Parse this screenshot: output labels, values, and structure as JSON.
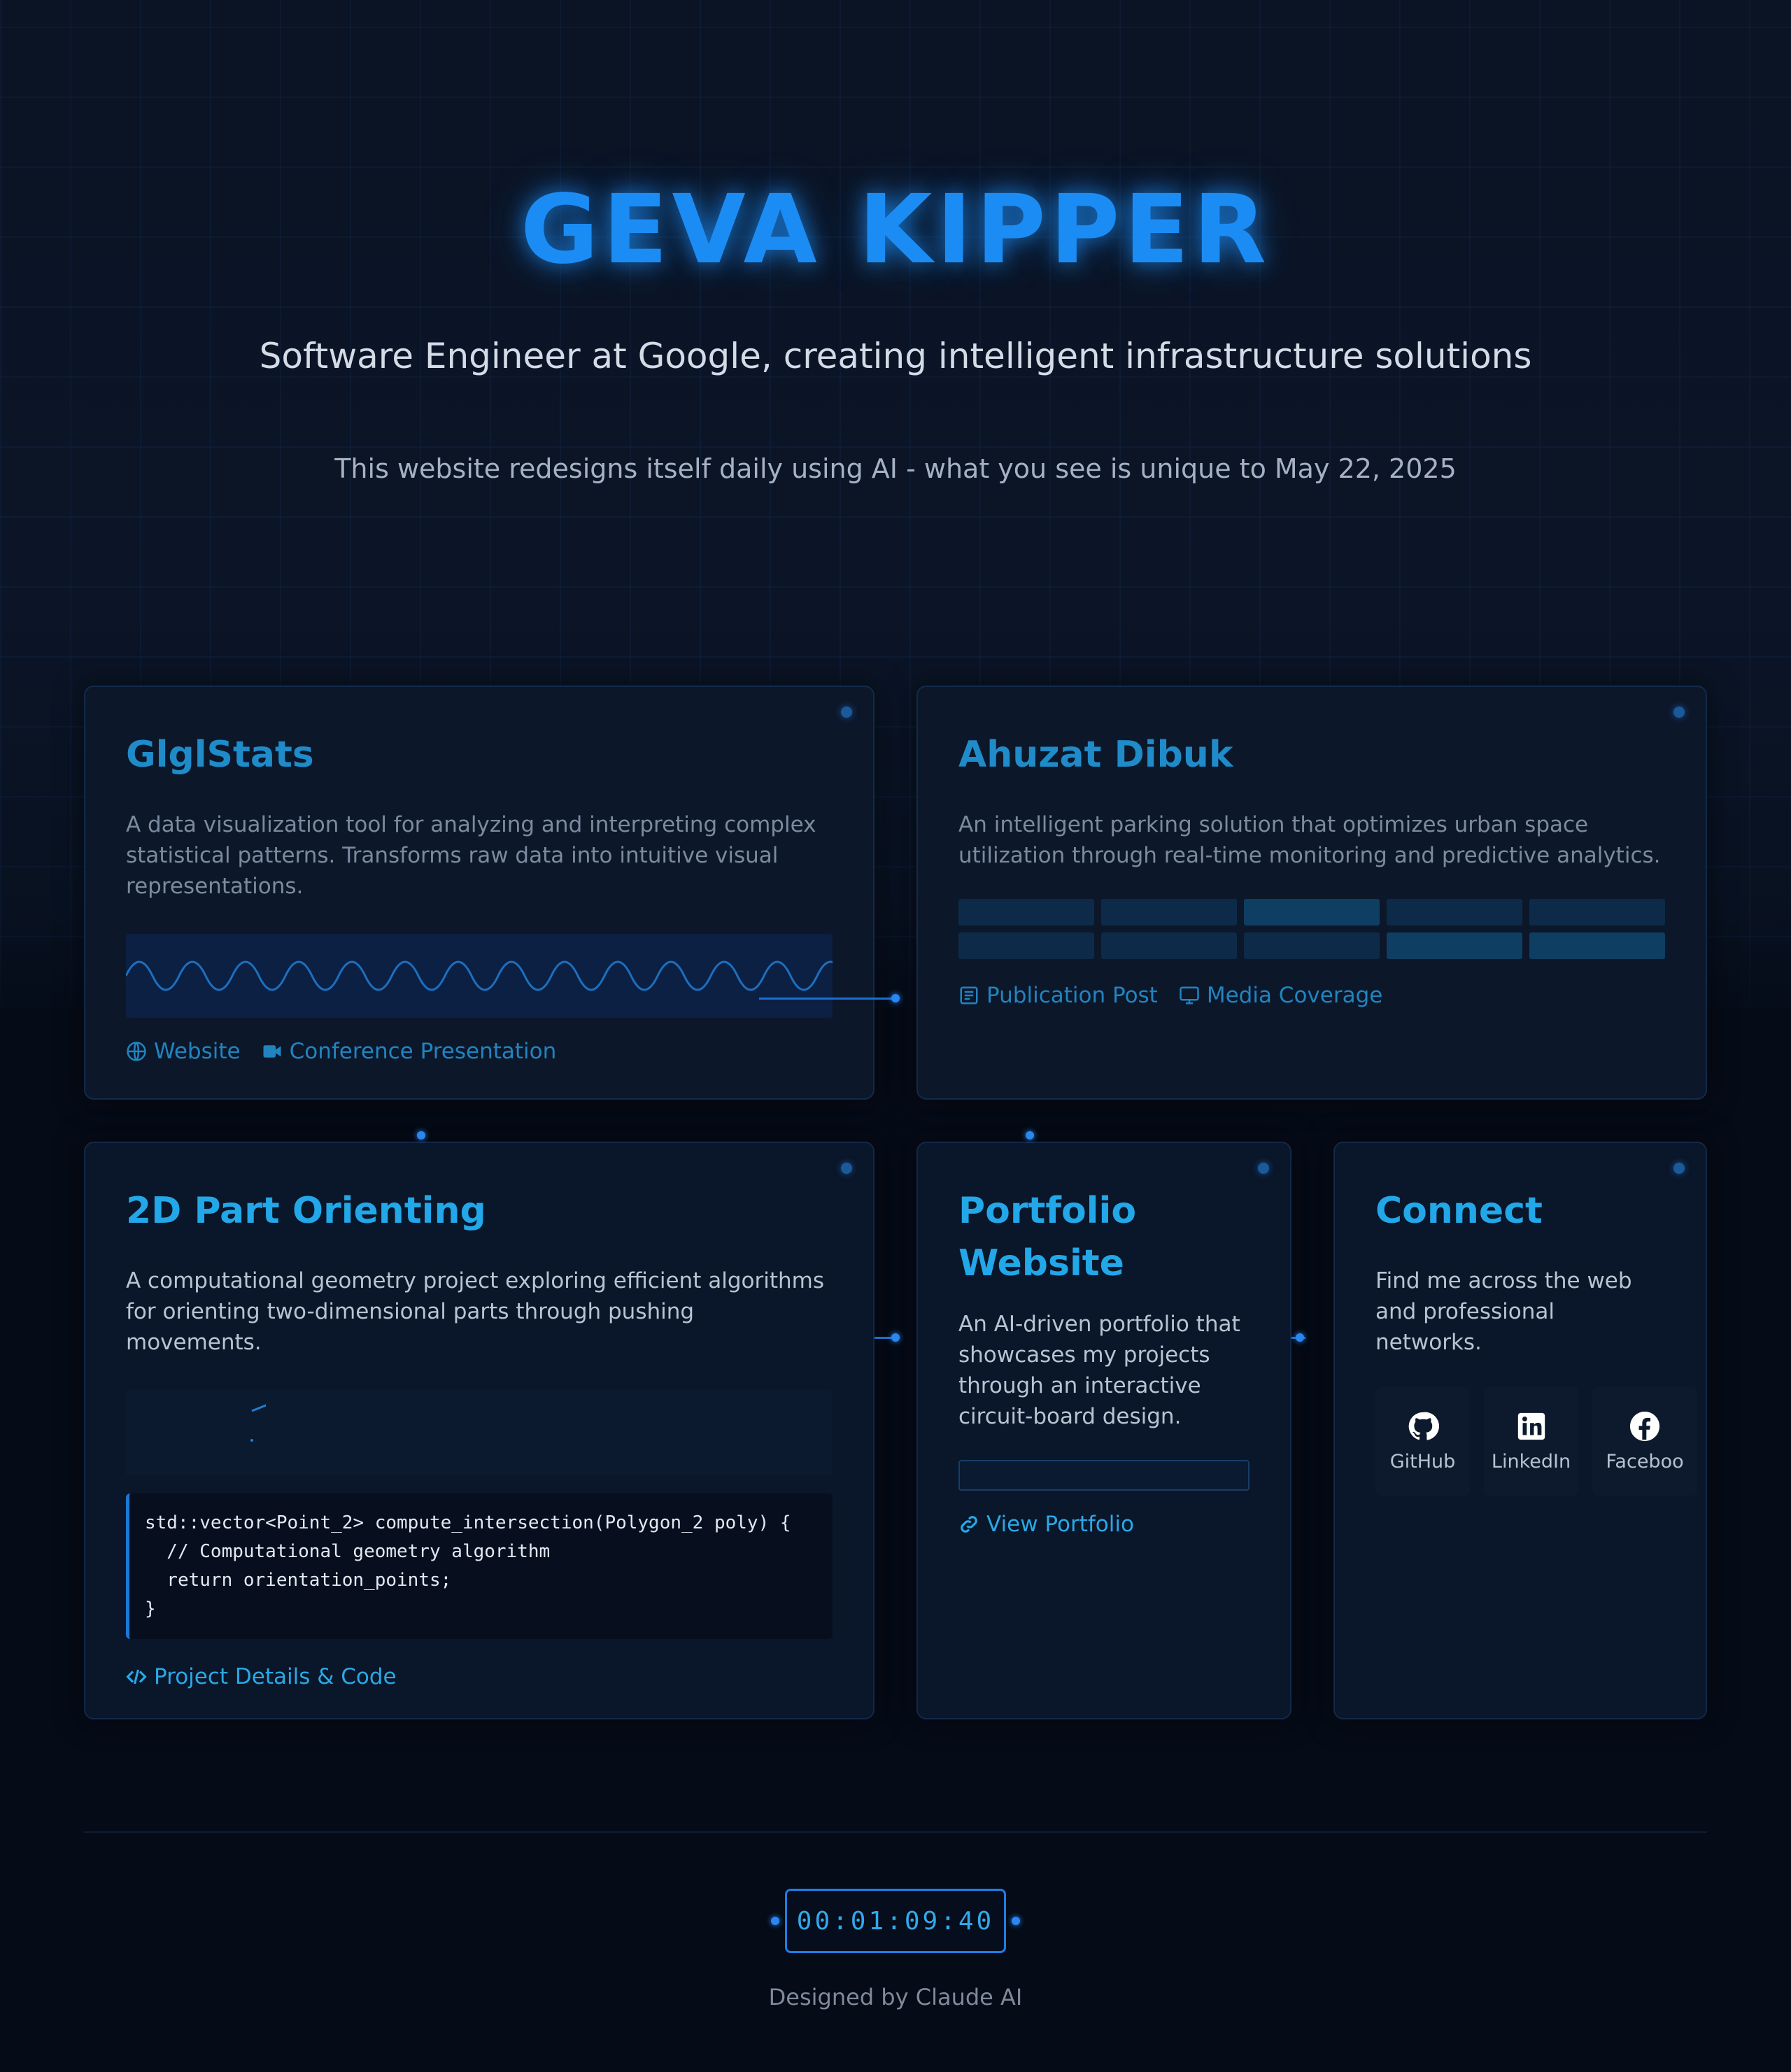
{
  "header": {
    "name": "GEVA KIPPER",
    "subtitle": "Software Engineer at Google, creating intelligent infrastructure solutions",
    "note": "This website redesigns itself daily using AI - what you see is unique to May 22, 2025"
  },
  "projects": {
    "glglstats": {
      "title": "GlglStats",
      "description": "A data visualization tool for analyzing and interpreting complex statistical patterns. Transforms raw data into intuitive visual representations.",
      "links": [
        "Website",
        "Conference Presentation"
      ]
    },
    "ahuzat": {
      "title": "Ahuzat Dibuk",
      "description": "An intelligent parking solution that optimizes urban space utilization through real-time monitoring and predictive analytics.",
      "links": [
        "Publication Post",
        "Media Coverage"
      ]
    },
    "orienting": {
      "title": "2D Part Orienting",
      "description": "A computational geometry project exploring efficient algorithms for orienting two-dimensional parts through pushing movements.",
      "code": "std::vector<Point_2> compute_intersection(Polygon_2 poly) {\n  // Computational geometry algorithm\n  return orientation_points;\n}",
      "link": "Project Details & Code"
    },
    "portfolio": {
      "title": "Portfolio Website",
      "description": "An AI-driven portfolio that showcases my projects through an interactive circuit-board design.",
      "link": "View Portfolio"
    }
  },
  "connect": {
    "title": "Connect",
    "description": "Find me across the web and professional networks.",
    "socials": [
      "GitHub",
      "LinkedIn",
      "Faceboo"
    ]
  },
  "footer": {
    "timer": "00:01:09:40",
    "credit": "Designed by Claude AI"
  },
  "colors": {
    "accent": "#1c8cf5",
    "title_accent": "#22a7e8",
    "background": "#050b17"
  }
}
